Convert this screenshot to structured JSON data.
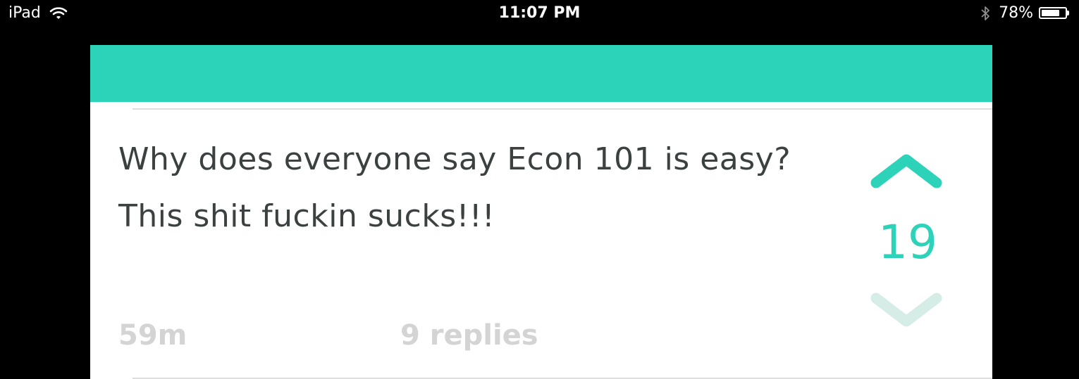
{
  "status_bar": {
    "device": "iPad",
    "time": "11:07 PM",
    "battery_percent": "78%",
    "battery_level": 0.78,
    "icons": [
      "wifi-icon",
      "bluetooth-icon",
      "battery-icon"
    ]
  },
  "colors": {
    "accent": "#2dd3b8",
    "text": "#3b4040",
    "meta": "#d4d4d4",
    "downvote": "#d6ece7"
  },
  "post": {
    "text": "Why does everyone say Econ 101 is easy? This shit fuckin sucks!!!",
    "time": "59m",
    "replies": "9 replies",
    "votes": "19"
  }
}
